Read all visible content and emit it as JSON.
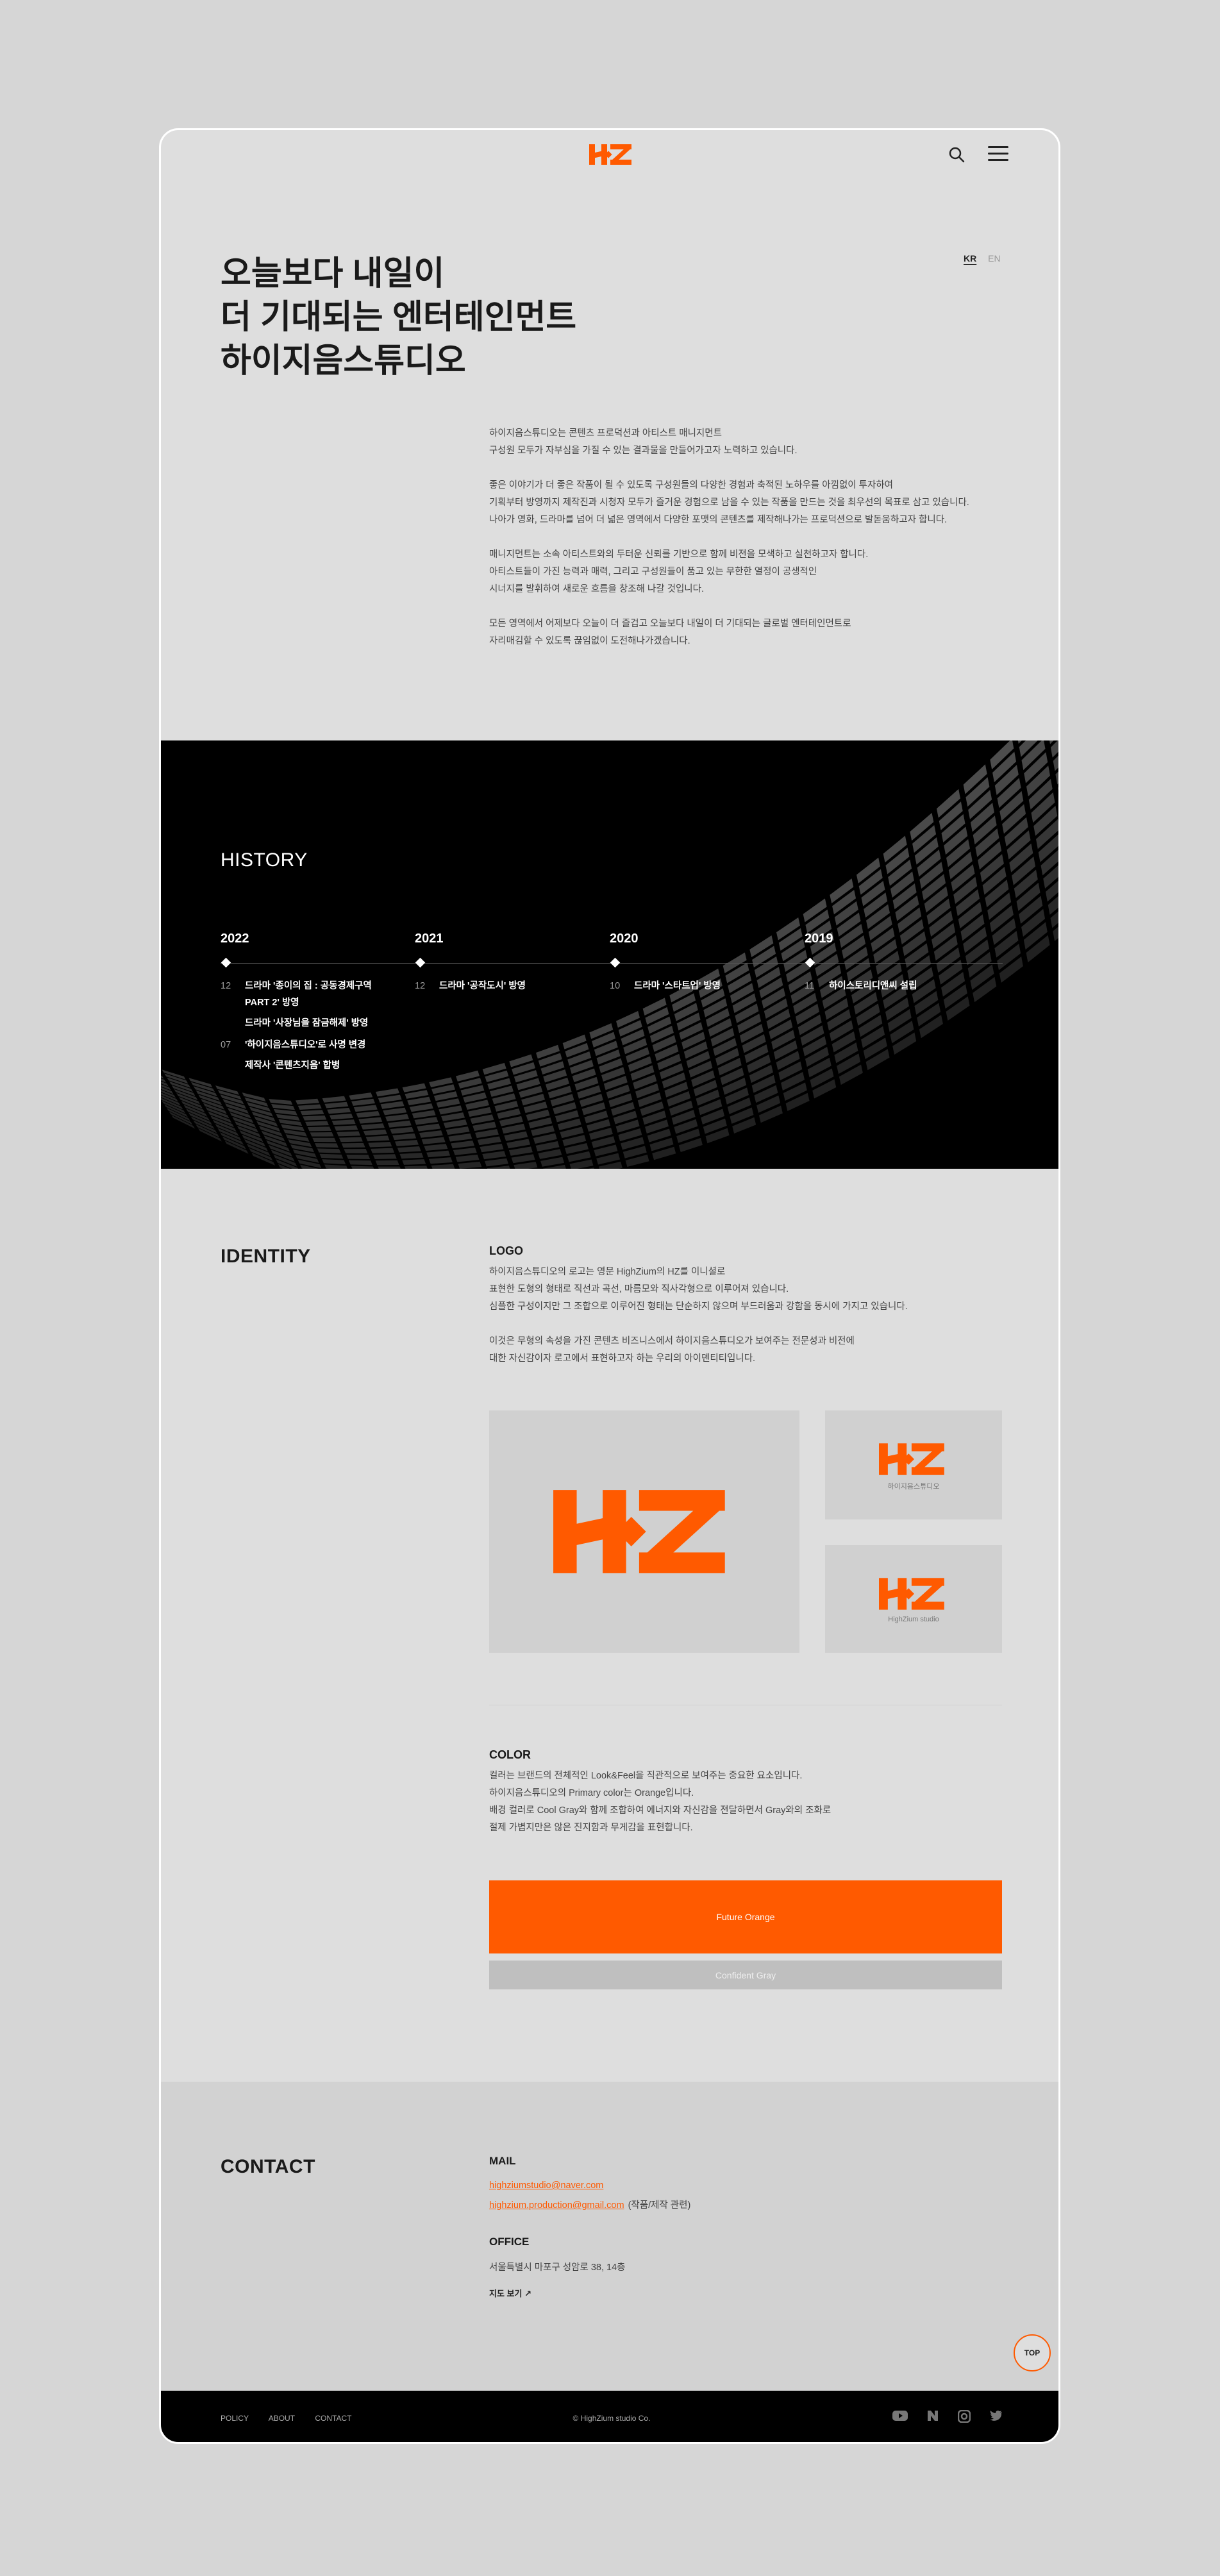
{
  "header": {
    "brand": "HZ"
  },
  "lang": {
    "kr": "KR",
    "en": "EN"
  },
  "hero": {
    "lines": [
      "오늘보다 내일이",
      "더 기대되는 엔터테인먼트",
      "하이지음스튜디오"
    ]
  },
  "intro": [
    [
      "하이지음스튜디오는 콘텐츠 프로덕션과 아티스트 매니지먼트",
      "구성원 모두가 자부심을 가질 수 있는 결과물을 만들어가고자 노력하고 있습니다."
    ],
    [
      "좋은 이야기가 더 좋은 작품이 될 수 있도록 구성원들의 다양한 경험과 축적된 노하우를 아낌없이 투자하여",
      "기획부터 방영까지 제작진과 시청자 모두가 즐거운 경험으로 남을 수 있는 작품을 만드는 것을 최우선의 목표로 삼고 있습니다.",
      "나아가 영화, 드라마를 넘어 더 넓은 영역에서 다양한 포맷의 콘텐츠를 제작해나가는 프로덕션으로 발돋움하고자 합니다."
    ],
    [
      "매니지먼트는 소속 아티스트와의 두터운 신뢰를 기반으로 함께 비전을 모색하고 실천하고자 합니다.",
      "아티스트들이 가진 능력과 매력, 그리고 구성원들이 품고 있는 무한한 열정이 공생적인",
      "시너지를 발휘하여 새로운 흐름을 창조해 나갈 것입니다."
    ],
    [
      "모든 영역에서 어제보다 오늘이 더 즐겁고 오늘보다 내일이 더 기대되는 글로벌 엔터테인먼트로",
      "자리매김할 수 있도록 끊임없이 도전해나가겠습니다."
    ]
  ],
  "history": {
    "title": "HISTORY",
    "years": [
      {
        "year": "2022",
        "events": [
          {
            "month": "12",
            "items": [
              "드라마 '종이의 집 : 공동경제구역 PART 2' 방영",
              "드라마 '사장님을 잠금해제' 방영"
            ]
          },
          {
            "month": "07",
            "items": [
              "'하이지음스튜디오'로 사명 변경",
              "제작사 '콘텐츠지음' 합병"
            ]
          }
        ]
      },
      {
        "year": "2021",
        "events": [
          {
            "month": "12",
            "items": [
              "드라마 '공작도시' 방영"
            ]
          }
        ]
      },
      {
        "year": "2020",
        "events": [
          {
            "month": "10",
            "items": [
              "드라마 '스타트업' 방영"
            ]
          }
        ]
      },
      {
        "year": "2019",
        "events": [
          {
            "month": "11",
            "items": [
              "하이스토리디앤씨 설립"
            ]
          }
        ]
      }
    ]
  },
  "identity": {
    "title": "IDENTITY",
    "logo_h": "LOGO",
    "logo_text": [
      [
        "하이지음스튜디오의 로고는 영문 HighZium의 HZ를 이니셜로",
        "표현한 도형의 형태로 직선과 곡선, 마름모와 직사각형으로 이루어져 있습니다.",
        "심플한 구성이지만 그 조합으로 이루어진 형태는 단순하지 않으며 부드러움과 강함을 동시에 가지고 있습니다."
      ],
      [
        "이것은 무형의 속성을 가진 콘텐츠 비즈니스에서 하이지음스튜디오가 보여주는 전문성과 비전에",
        "대한 자신감이자 로고에서 표현하고자 하는 우리의 아이덴티티입니다."
      ]
    ],
    "logo_caption_kr": "하이지음스튜디오",
    "logo_caption_en": "HighZium studio",
    "color_h": "COLOR",
    "color_text": [
      "컬러는 브랜드의 전체적인 Look&Feel을 직관적으로 보여주는 중요한 요소입니다.",
      "하이지음스튜디오의 Primary color는 Orange입니다.",
      "배경 컬러로 Cool Gray와 함께 조합하여 에너지와 자신감을 전달하면서 Gray와의 조화로",
      "절제 가볍지만은 않은 진지함과 무게감을 표현합니다."
    ],
    "colors": [
      {
        "name": "Future Orange",
        "hex": "#ff5a00"
      },
      {
        "name": "Confident Gray",
        "hex": "#bfbfbf"
      }
    ]
  },
  "contact": {
    "title": "CONTACT",
    "mail_h": "MAIL",
    "mail1": "highziumstudio@naver.com",
    "mail2": "highzium.production@gmail.com",
    "mail2_note": "(작품/제작 관련)",
    "office_h": "OFFICE",
    "address": "서울특별시 마포구 성암로 38, 14층",
    "map_link": "지도 보기 ↗"
  },
  "top_button": "TOP",
  "footer": {
    "links": [
      "POLICY",
      "ABOUT",
      "CONTACT"
    ],
    "copyright": "© HighZium studio Co.",
    "social_icons": [
      "youtube-icon",
      "naver-icon",
      "instagram-icon",
      "twitter-icon"
    ]
  },
  "colors": {
    "accent": "#ff5a00",
    "page_bg": "#d6d6d6",
    "frame_bg": "#dedede",
    "dark": "#000000"
  }
}
